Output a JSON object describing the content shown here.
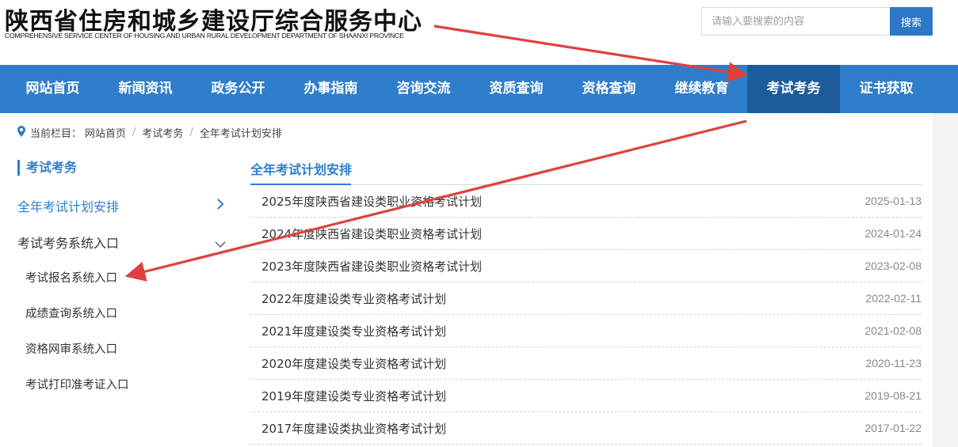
{
  "header": {
    "title": "陕西省住房和城乡建设厅综合服务中心",
    "subtitle": "COMPREHENSIVE SERVICE CENTER OF HOUSING AND URBAN RURAL DEVELOPMENT DEPARTMENT OF SHAANXI PROVINCE"
  },
  "search": {
    "placeholder": "请输入要搜索的内容",
    "button_label": "搜索"
  },
  "nav": {
    "items": [
      {
        "label": "网站首页"
      },
      {
        "label": "新闻资讯"
      },
      {
        "label": "政务公开"
      },
      {
        "label": "办事指南"
      },
      {
        "label": "咨询交流"
      },
      {
        "label": "资质查询"
      },
      {
        "label": "资格查询"
      },
      {
        "label": "继续教育"
      },
      {
        "label": "考试考务"
      },
      {
        "label": "证书获取"
      }
    ],
    "active_index": 8
  },
  "breadcrumb": {
    "prefix": "当前栏目：",
    "items": [
      "网站首页",
      "考试考务",
      "全年考试计划安排"
    ]
  },
  "sidebar": {
    "title": "考试考务",
    "active_link": "全年考试计划安排",
    "group_label": "考试考务系统入口",
    "sub_links": [
      "考试报名系统入口",
      "成绩查询系统入口",
      "资格网审系统入口",
      "考试打印准考证入口"
    ]
  },
  "content": {
    "title": "全年考试计划安排",
    "rows": [
      {
        "title": "2025年度陕西省建设类职业资格考试计划",
        "date": "2025-01-13"
      },
      {
        "title": "2024年度陕西省建设类职业资格考试计划",
        "date": "2024-01-24"
      },
      {
        "title": "2023年度陕西省建设类职业资格考试计划",
        "date": "2023-02-08"
      },
      {
        "title": "2022年度建设类专业资格考试计划",
        "date": "2022-02-11"
      },
      {
        "title": "2021年度建设类专业资格考试计划",
        "date": "2021-02-08"
      },
      {
        "title": "2020年度建设类专业资格考试计划",
        "date": "2020-11-23"
      },
      {
        "title": "2019年度建设类专业资格考试计划",
        "date": "2019-08-21"
      },
      {
        "title": "2017年度建设类执业资格考试计划",
        "date": "2017-01-22"
      }
    ]
  },
  "colors": {
    "primary": "#2f7ecb",
    "nav_active": "#1d5c9c",
    "annotation_arrow": "#e04040"
  },
  "icons": {
    "breadcrumb": "location-pin-icon",
    "expanded": "chevron-right-icon",
    "collapsed": "chevron-down-icon"
  }
}
